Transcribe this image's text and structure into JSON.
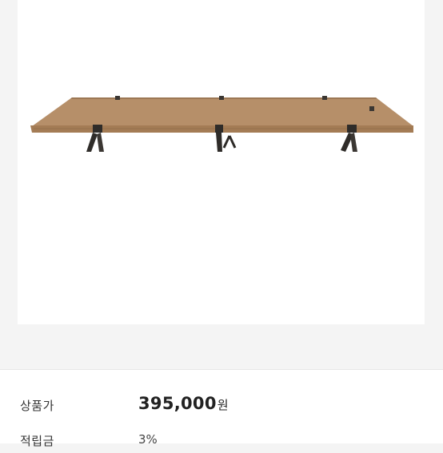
{
  "product": {
    "image_icon": "camping-cot-image"
  },
  "info": {
    "price_label": "상품가",
    "price_value": "395,000",
    "price_unit": "원",
    "points_label": "적립금",
    "points_value": "3%"
  },
  "colors": {
    "page_background": "#f4f4f4",
    "cot_fabric": "#b58d66",
    "cot_frame": "#2d2a27"
  }
}
